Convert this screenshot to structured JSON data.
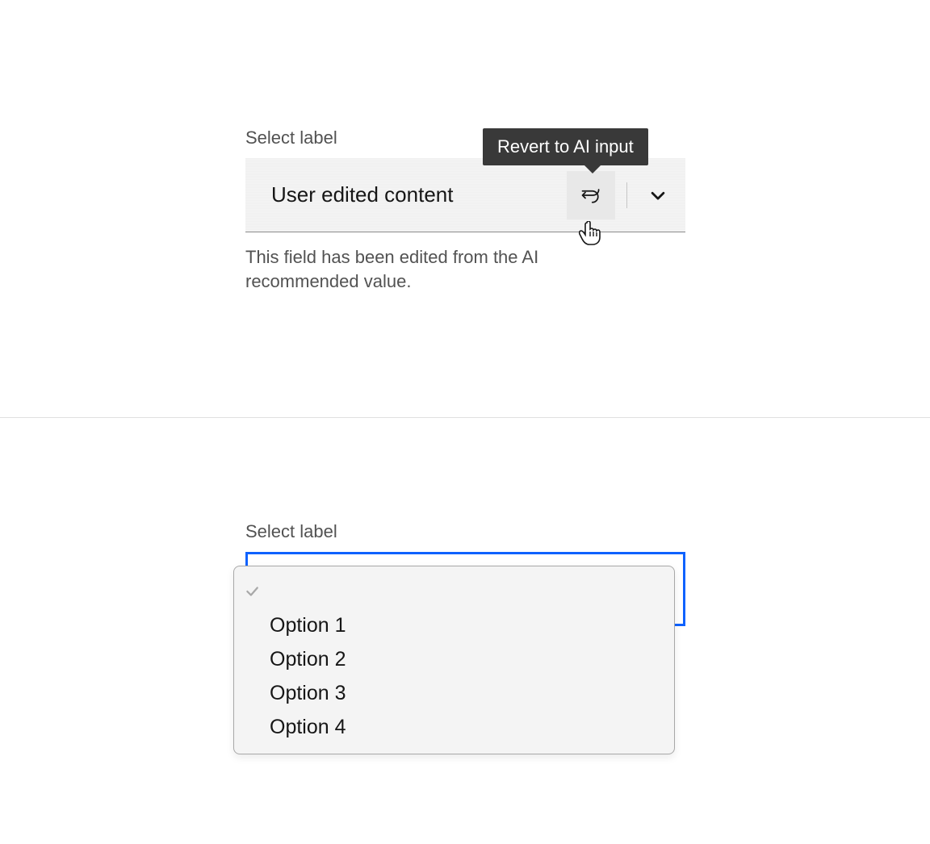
{
  "colors": {
    "text": "#161616",
    "secondary": "#525252",
    "field_bg": "#f4f4f4",
    "tooltip_bg": "#393939",
    "focus_border": "#0f62fe",
    "dropdown_border": "#a8a8a8"
  },
  "section1": {
    "label": "Select label",
    "value": "User edited content",
    "helper_text": "This field has been edited from the AI recommended value.",
    "tooltip": "Revert to AI input",
    "icons": {
      "revert": "undo-icon",
      "chevron": "chevron-down-icon",
      "cursor": "pointer-cursor-icon"
    }
  },
  "section2": {
    "label": "Select label",
    "selected_value": "",
    "options": [
      {
        "label": "",
        "selected": true
      },
      {
        "label": "Option 1",
        "selected": false
      },
      {
        "label": "Option 2",
        "selected": false
      },
      {
        "label": "Option 3",
        "selected": false
      },
      {
        "label": "Option 4",
        "selected": false
      }
    ],
    "icons": {
      "check": "checkmark-icon"
    }
  }
}
